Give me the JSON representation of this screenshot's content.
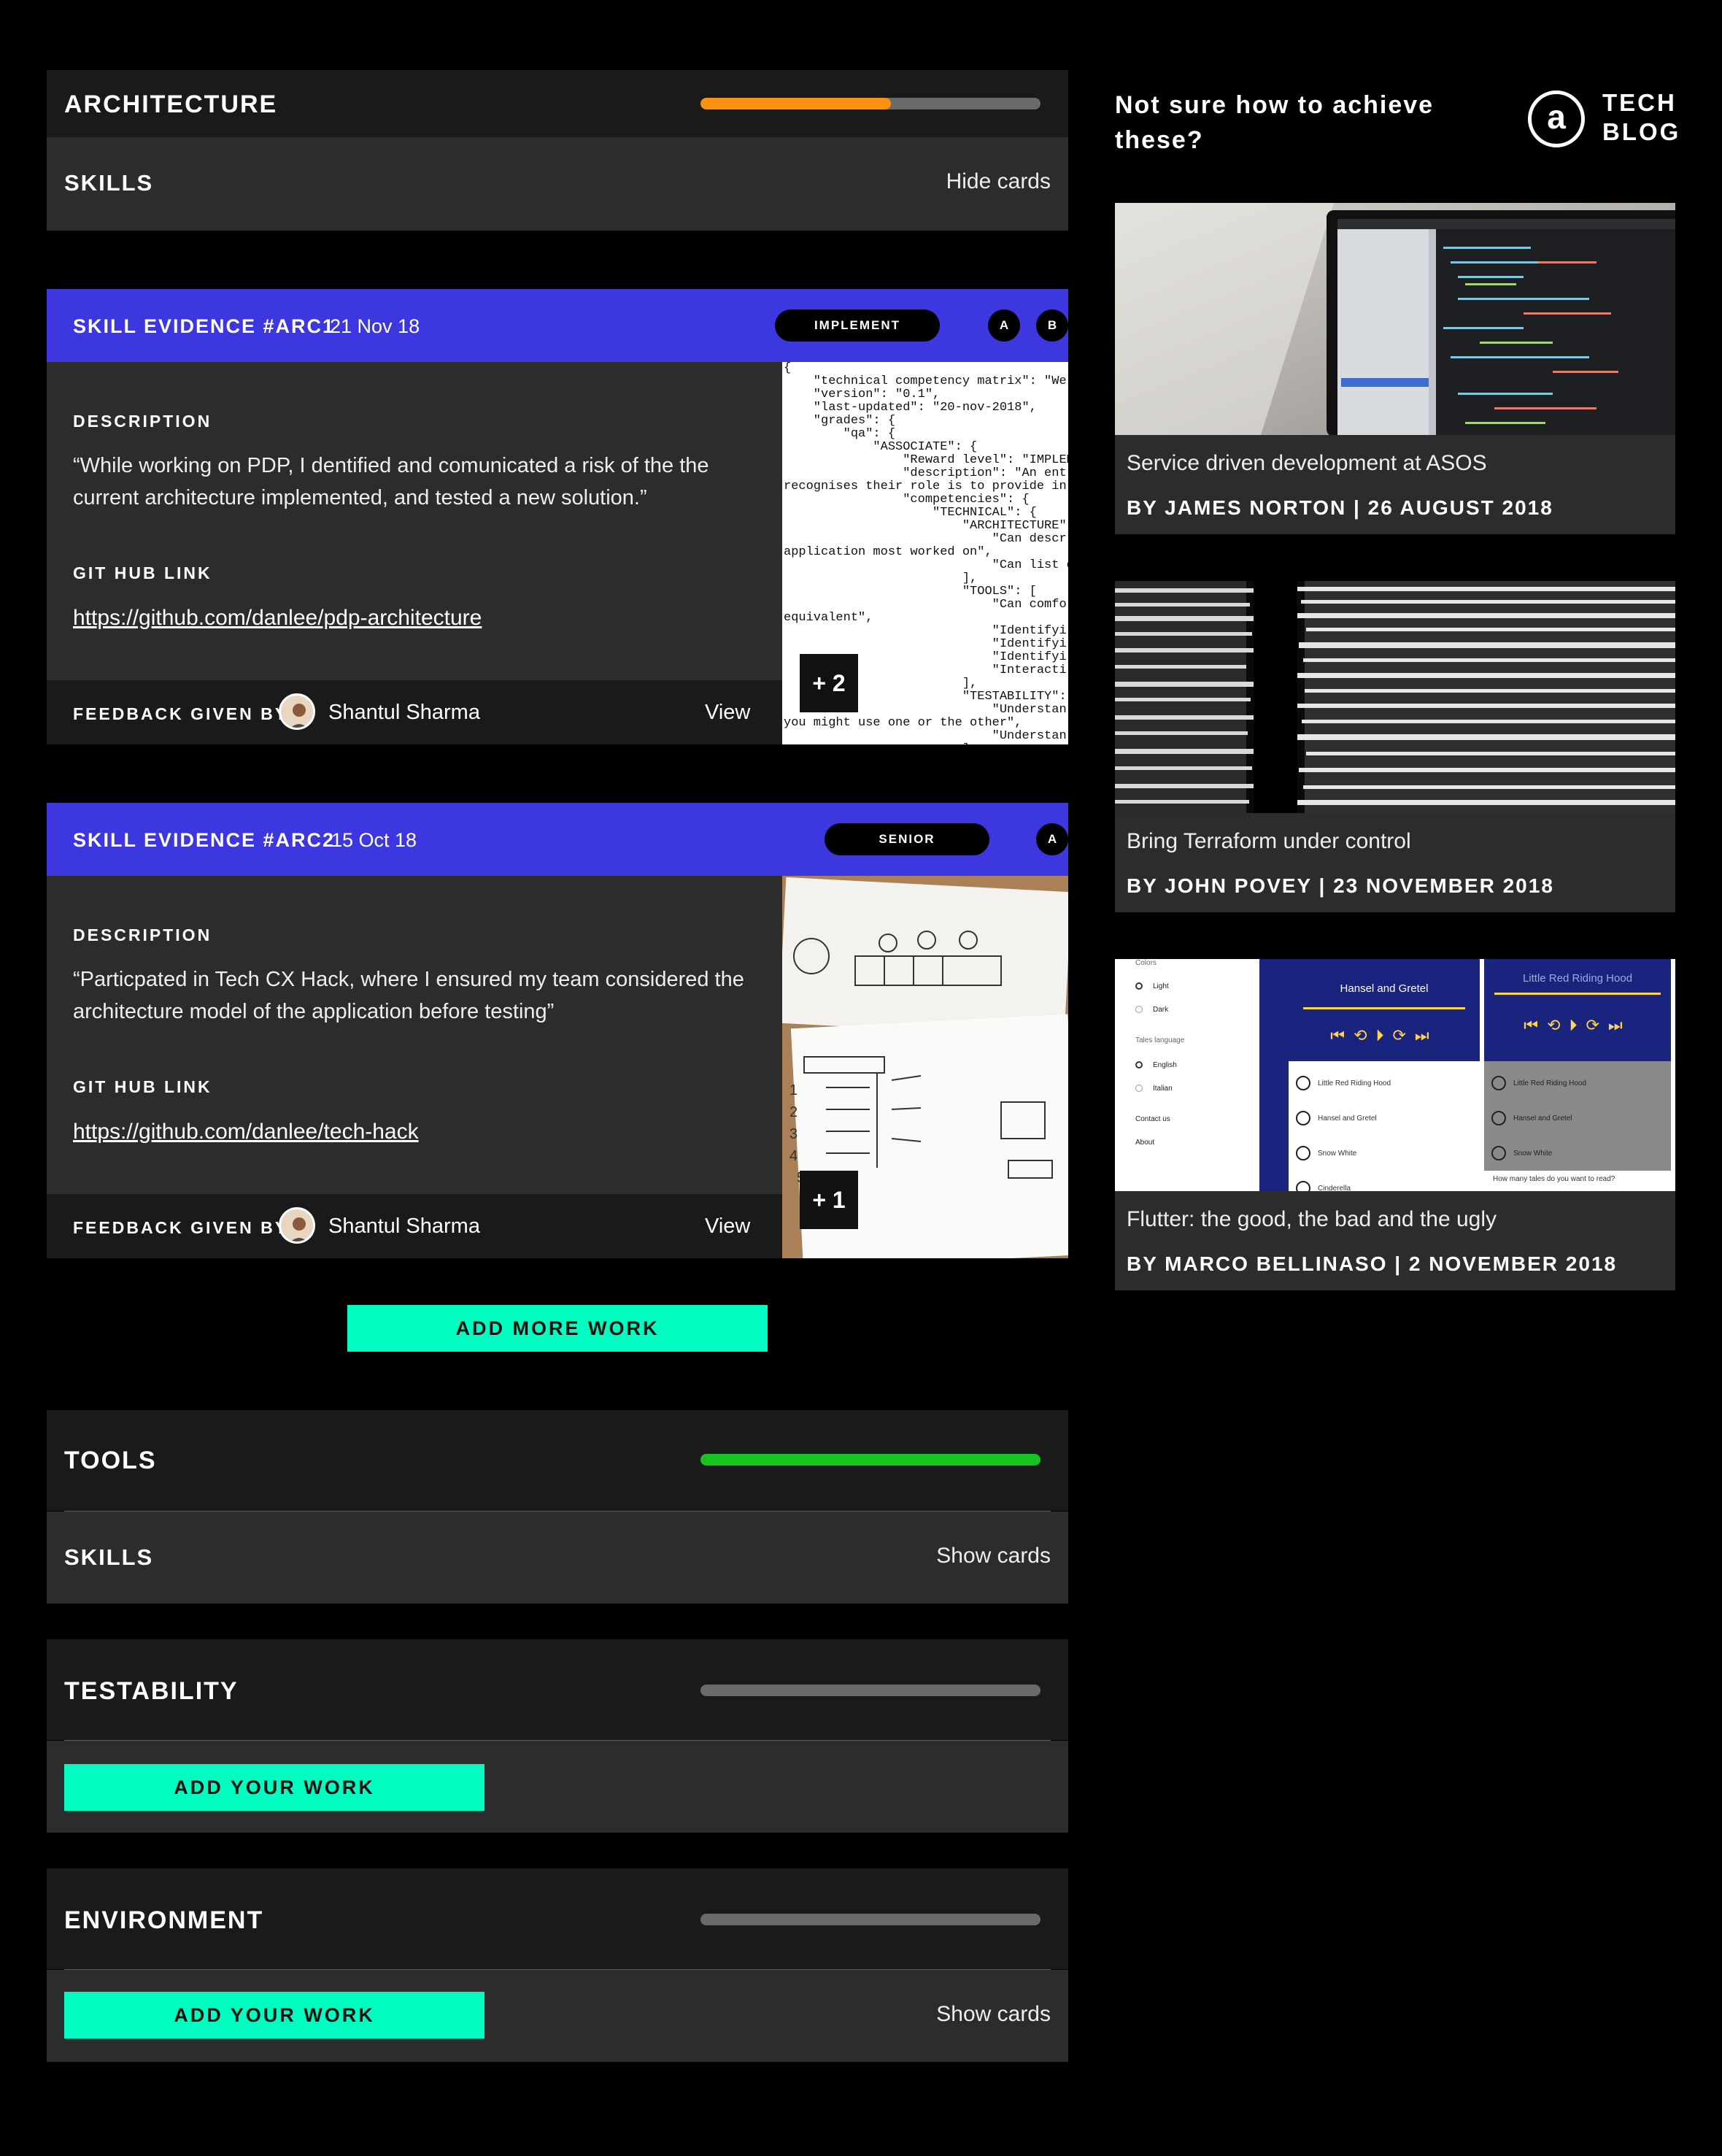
{
  "architecture": {
    "title": "ARCHITECTURE",
    "progress": 0.56,
    "progress_color": "#f7910f",
    "skills_label": "SKILLS",
    "toggle_label": "Hide cards"
  },
  "evidence": [
    {
      "title": "SKILL EVIDENCE #ARC1",
      "date": "21 Nov 18",
      "level": "IMPLEMENT",
      "badges": [
        "A",
        "B"
      ],
      "description_label": "DESCRIPTION",
      "description": "“While working on PDP, I dentified and comunicated a risk of the the current architecture implemented, and tested a new solution.”",
      "link_label": "GIT HUB LINK",
      "link": "https://github.com/danlee/pdp-architecture",
      "feedback_label": "FEEDBACK GIVEN BY",
      "reviewer": "Shantul Sharma",
      "view_label": "View",
      "more_count": "+ 2",
      "code_preview": "{\n    \"technical competency matrix\": \"We\n    \"version\": \"0.1\",\n    \"last-updated\": \"20-nov-2018\",\n    \"grades\": {\n        \"qa\": {\n            \"ASSOCIATE\": {\n                \"Reward level\": \"IMPLEM\n                \"description\": \"An ent\nrecognises their role is to provide in\n                \"competencies\": {\n                    \"TECHNICAL\": {\n                        \"ARCHITECTURE\"\n                            \"Can descr\napplication most worked on\",\n                            \"Can list o\n                        ],\n                        \"TOOLS\": [\n                            \"Can comfo\nequivalent\",\n                            \"Identifyi\n                            \"Identifyi\n                            \"Identifyi\n                            \"Interacti\n                        ],\n                        \"TESTABILITY\":\n                            \"Understan\nyou might use one or the other\",\n                            \"Understan\n                        ],"
    },
    {
      "title": "SKILL EVIDENCE #ARC2",
      "date": "15 Oct 18",
      "level": "SENIOR",
      "badges": [
        "A"
      ],
      "description_label": "DESCRIPTION",
      "description": "“Particpated in Tech CX Hack, where I ensured my team considered the architecture model of the application before testing”",
      "link_label": "GIT HUB LINK",
      "link": "https://github.com/danlee/tech-hack",
      "feedback_label": "FEEDBACK GIVEN BY",
      "reviewer": "Shantul Sharma",
      "view_label": "View",
      "more_count": "+ 1"
    }
  ],
  "add_more_work_label": "ADD MORE WORK",
  "tools": {
    "title": "TOOLS",
    "progress": 1.0,
    "progress_color": "#15c41f",
    "skills_label": "SKILLS",
    "toggle_label": "Show cards"
  },
  "testability": {
    "title": "TESTABILITY",
    "progress": 0,
    "add_label": "ADD YOUR WORK"
  },
  "environment": {
    "title": "ENVIRONMENT",
    "progress": 0,
    "add_label": "ADD YOUR WORK",
    "toggle_label": "Show cards"
  },
  "sidebar": {
    "prompt": "Not sure how to achieve these?",
    "logo_mark": "a",
    "logo_line1": "TECH",
    "logo_line2": "BLOG",
    "articles": [
      {
        "title": "Service driven development at ASOS",
        "byline": "BY JAMES NORTON | 26 AUGUST 2018"
      },
      {
        "title": "Bring Terraform under control",
        "byline": "BY JOHN POVEY | 23 NOVEMBER 2018"
      },
      {
        "title": "Flutter: the good, the bad and the ugly",
        "byline": "BY MARCO BELLINASO | 2 NOVEMBER 2018"
      }
    ]
  },
  "phone_ui": {
    "colors_label": "Colors",
    "light": "Light",
    "dark": "Dark",
    "tales_language": "Tales language",
    "english": "English",
    "italian": "Italian",
    "contact": "Contact us",
    "about": "About",
    "story1": "Hansel and Gretel",
    "story2": "Little Red Riding Hood",
    "list": [
      "Little Red Riding Hood",
      "Hansel and Gretel",
      "Snow White",
      "Cinderella"
    ],
    "list_b": [
      "Little Red Riding Hood",
      "Hansel and Gretel",
      "Snow White"
    ],
    "question": "How many tales do you want to read?"
  },
  "colors": {
    "accent_purple": "#3d37e0",
    "cta_green": "#00fcc0",
    "progress_orange": "#f7910f",
    "progress_green": "#15c41f"
  }
}
